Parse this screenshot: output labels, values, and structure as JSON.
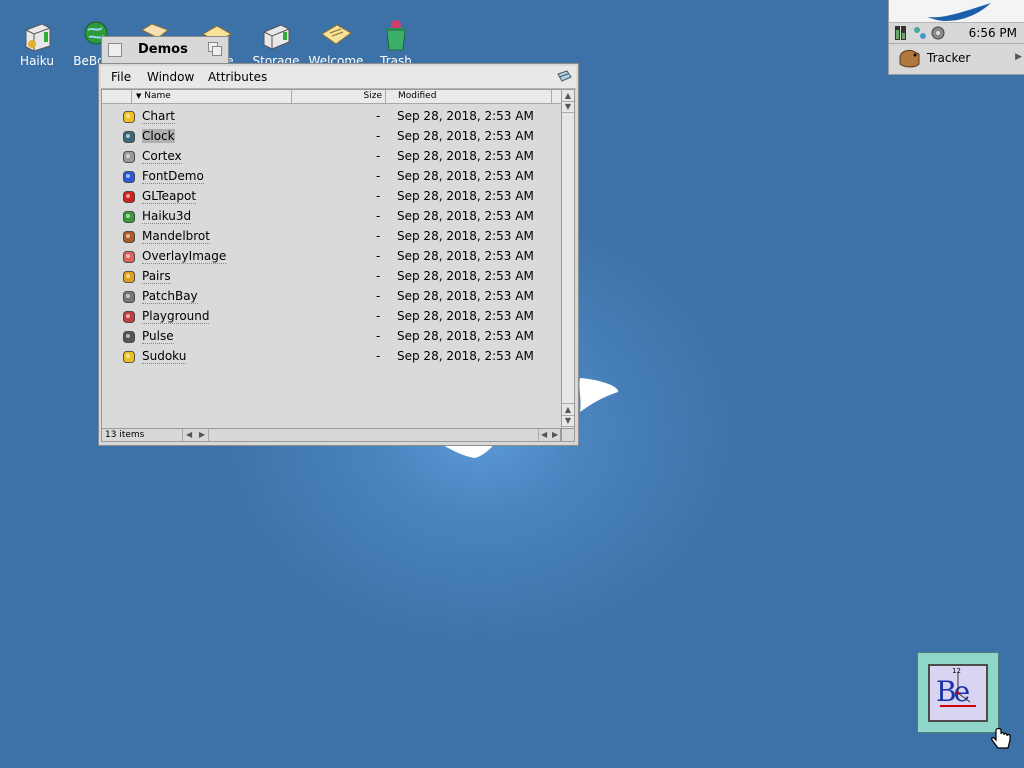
{
  "desktop": {
    "icons": [
      {
        "label": "Haiku",
        "icon": "disk-drive-icon"
      },
      {
        "label": "BeBook",
        "icon": "globe-icon"
      },
      {
        "label": "",
        "icon": "folder-icon"
      },
      {
        "label": "Guide",
        "icon": "folder-icon"
      },
      {
        "label": "Storage",
        "icon": "disk-drive-icon"
      },
      {
        "label": "Welcome",
        "icon": "document-icon"
      },
      {
        "label": "Trash",
        "icon": "trash-icon"
      }
    ]
  },
  "deskbar": {
    "time": "6:56 PM",
    "tracker_label": "Tracker"
  },
  "window": {
    "title": "Demos",
    "menu": {
      "file": "File",
      "window": "Window",
      "attributes": "Attributes"
    },
    "columns": {
      "name": "Name",
      "size": "Size",
      "modified": "Modified"
    },
    "files": [
      {
        "name": "Chart",
        "size": "-",
        "modified": "Sep 28, 2018, 2:53 AM",
        "icon": "chart-app-icon"
      },
      {
        "name": "Clock",
        "size": "-",
        "modified": "Sep 28, 2018, 2:53 AM",
        "icon": "clock-app-icon",
        "selected": true
      },
      {
        "name": "Cortex",
        "size": "-",
        "modified": "Sep 28, 2018, 2:53 AM",
        "icon": "cortex-app-icon"
      },
      {
        "name": "FontDemo",
        "size": "-",
        "modified": "Sep 28, 2018, 2:53 AM",
        "icon": "fontdemo-app-icon"
      },
      {
        "name": "GLTeapot",
        "size": "-",
        "modified": "Sep 28, 2018, 2:53 AM",
        "icon": "teapot-app-icon"
      },
      {
        "name": "Haiku3d",
        "size": "-",
        "modified": "Sep 28, 2018, 2:53 AM",
        "icon": "haiku3d-app-icon"
      },
      {
        "name": "Mandelbrot",
        "size": "-",
        "modified": "Sep 28, 2018, 2:53 AM",
        "icon": "mandelbrot-app-icon"
      },
      {
        "name": "OverlayImage",
        "size": "-",
        "modified": "Sep 28, 2018, 2:53 AM",
        "icon": "overlay-app-icon"
      },
      {
        "name": "Pairs",
        "size": "-",
        "modified": "Sep 28, 2018, 2:53 AM",
        "icon": "pairs-app-icon"
      },
      {
        "name": "PatchBay",
        "size": "-",
        "modified": "Sep 28, 2018, 2:53 AM",
        "icon": "patchbay-app-icon"
      },
      {
        "name": "Playground",
        "size": "-",
        "modified": "Sep 28, 2018, 2:53 AM",
        "icon": "playground-app-icon"
      },
      {
        "name": "Pulse",
        "size": "-",
        "modified": "Sep 28, 2018, 2:53 AM",
        "icon": "pulse-app-icon"
      },
      {
        "name": "Sudoku",
        "size": "-",
        "modified": "Sep 28, 2018, 2:53 AM",
        "icon": "sudoku-app-icon"
      }
    ],
    "status": "13 items"
  },
  "clock_widget": {
    "logo_text": "Be",
    "twelve": "12"
  },
  "colors": {
    "desktop": "#3d72a8",
    "panel": "#d8d8d8",
    "selection": "#b0b0b0"
  }
}
